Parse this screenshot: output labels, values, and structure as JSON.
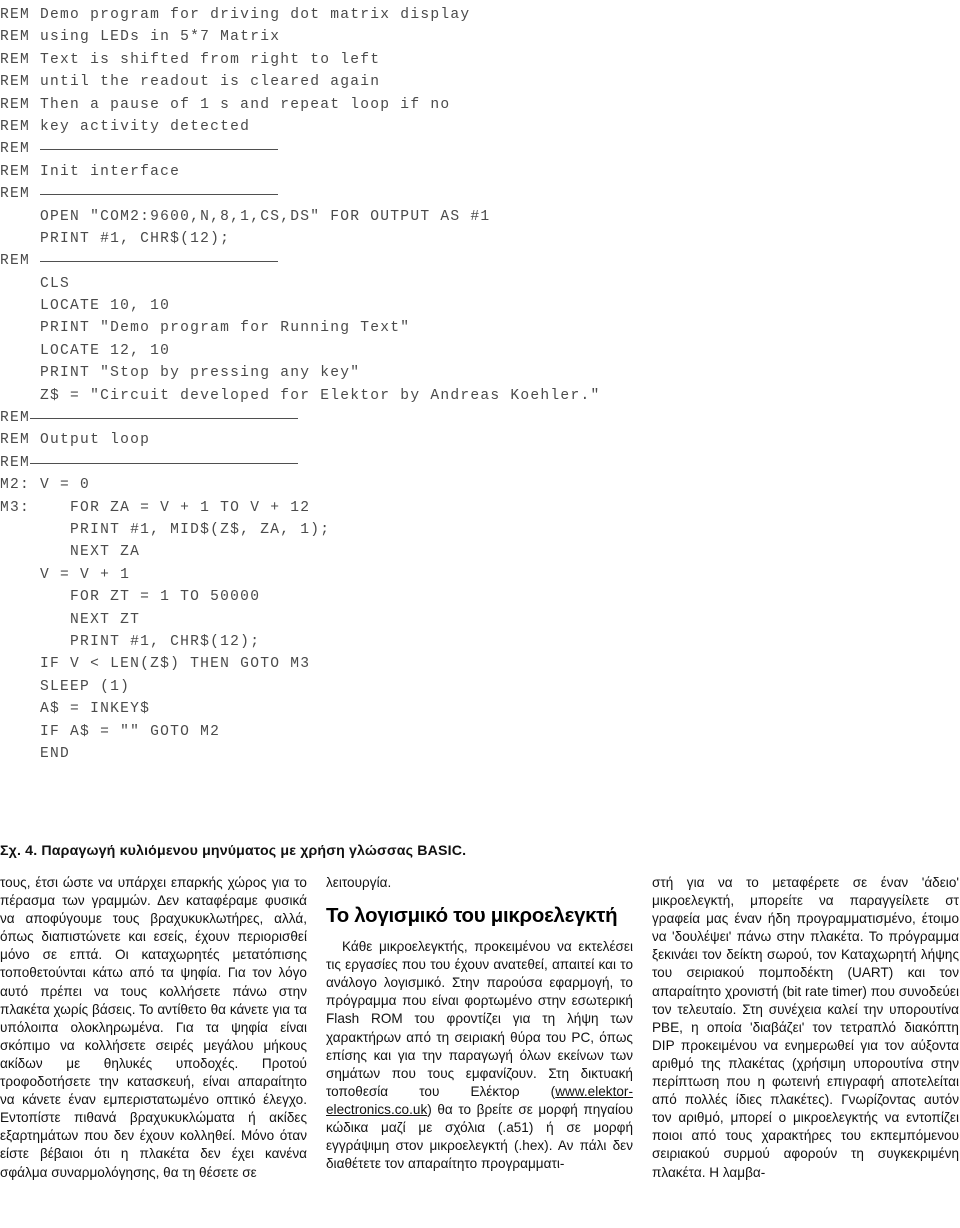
{
  "listing": {
    "lines": [
      {
        "type": "text",
        "text": "REM Demo program for driving dot matrix display"
      },
      {
        "type": "text",
        "text": "REM using LEDs in 5*7 Matrix"
      },
      {
        "type": "text",
        "text": "REM Text is shifted from right to left"
      },
      {
        "type": "text",
        "text": "REM until the readout is cleared again"
      },
      {
        "type": "text",
        "text": "REM Then a pause of 1 s and repeat loop if no"
      },
      {
        "type": "text",
        "text": "REM key activity detected"
      },
      {
        "type": "rule",
        "text": "REM",
        "style": "wide"
      },
      {
        "type": "text",
        "text": "REM Init interface"
      },
      {
        "type": "rule",
        "text": "REM",
        "style": "wide"
      },
      {
        "type": "text",
        "text": "    OPEN \"COM2:9600,N,8,1,CS,DS\" FOR OUTPUT AS #1"
      },
      {
        "type": "text",
        "text": "    PRINT #1, CHR$(12);"
      },
      {
        "type": "rule",
        "text": "REM",
        "style": "wide"
      },
      {
        "type": "text",
        "text": "    CLS"
      },
      {
        "type": "text",
        "text": "    LOCATE 10, 10"
      },
      {
        "type": "text",
        "text": "    PRINT \"Demo program for Running Text\""
      },
      {
        "type": "text",
        "text": "    LOCATE 12, 10"
      },
      {
        "type": "text",
        "text": "    PRINT \"Stop by pressing any key\""
      },
      {
        "type": "text",
        "text": "    Z$ = \"Circuit developed for Elektor by Andreas Koehler.\""
      },
      {
        "type": "rule",
        "text": "REM",
        "style": "tight"
      },
      {
        "type": "text",
        "text": "REM Output loop"
      },
      {
        "type": "rule",
        "text": "REM",
        "style": "tight"
      },
      {
        "type": "text",
        "text": "M2: V = 0"
      },
      {
        "type": "text",
        "text": "M3:    FOR ZA = V + 1 TO V + 12"
      },
      {
        "type": "text",
        "text": "       PRINT #1, MID$(Z$, ZA, 1);"
      },
      {
        "type": "text",
        "text": "       NEXT ZA"
      },
      {
        "type": "text",
        "text": "    V = V + 1"
      },
      {
        "type": "text",
        "text": "       FOR ZT = 1 TO 50000"
      },
      {
        "type": "text",
        "text": "       NEXT ZT"
      },
      {
        "type": "text",
        "text": "       PRINT #1, CHR$(12);"
      },
      {
        "type": "text",
        "text": "    IF V < LEN(Z$) THEN GOTO M3"
      },
      {
        "type": "text",
        "text": "    SLEEP (1)"
      },
      {
        "type": "text",
        "text": "    A$ = INKEY$"
      },
      {
        "type": "text",
        "text": "    IF A$ = \"\" GOTO M2"
      },
      {
        "type": "text",
        "text": "    END"
      }
    ]
  },
  "caption": {
    "number": "Σχ. 4.",
    "text": "Παραγωγή κυλιόμενου μηνύματος με χρήση γλώσσας BASIC.",
    "full": "Σχ. 4. Παραγωγή κυλιόμενου μηνύματος με χρήση γλώσσας BASIC."
  },
  "article": {
    "column1": {
      "paragraph": "τους, έτσι ώστε να υπάρχει επαρκής χώρος για το πέρασμα των γραμμών. Δεν καταφέραμε φυσικά να αποφύγουμε τους βραχυκυκλωτήρες, αλλά, όπως διαπιστώνετε και εσείς, έχουν περιορισθεί μόνο σε επτά. Οι καταχωρητές μετατόπισης τοποθετούνται κάτω από τα ψηφία. Για τον λόγο αυτό πρέπει να τους κολλήσετε πάνω στην πλακέτα χωρίς βάσεις. Το αντίθετο θα κάνετε για τα υπόλοιπα ολοκληρωμένα. Για τα ψηφία είναι σκόπιμο να κολλήσετε σειρές μεγάλου μήκους ακίδων με θηλυκές υποδοχές. Προτού τροφοδοτήσετε την κατασκευή, είναι απαραίτητο να κάνετε έναν εμπεριστατωμένο οπτικό έλεγχο. Εντοπίστε πιθανά βραχυκυκλώματα ή ακίδες εξαρτημάτων που δεν έχουν κολληθεί. Μόνο όταν είστε βέβαιοι ότι η πλακέτα δεν έχει κανένα σφάλμα συναρμολόγησης, θα τη θέσετε σε"
    },
    "column2": {
      "paragraph_top": "λειτουργία.",
      "heading": "Το λογισμικό του μικροελεγκτή",
      "paragraph_body_before_link": "Κάθε μικροελεγκτής, προκειμένου να εκτελέσει τις εργασίες που του έχουν ανατεθεί, απαιτεί και το ανάλογο λογισμικό. Στην παρούσα εφαρμογή, το πρόγραμμα που είναι φορτωμένο στην εσωτερική Flash ROM του φροντίζει για τη λήψη των χαρακτήρων από τη σειριακή θύρα του PC, όπως επίσης και για την παραγωγή όλων εκείνων των σημάτων που τους εμφανίζουν. Στη δικτυακή τοποθεσία του Ελέκτορ (",
      "link_text": "www.elektor-electronics.co.uk",
      "paragraph_body_after_link": ") θα το βρείτε σε μορφή πηγαίου κώδικα μαζί με σχόλια (.a51) ή σε μορφή εγγράψιμη στον μικροελεγκτή (.hex). Αν πάλι δεν διαθέτετε τον απαραίτητο προγραμματι-"
    },
    "column3": {
      "paragraph": "στή για να το μεταφέρετε σε έναν 'άδειο' μικροελεγκτή, μπορείτε να παραγγείλετε στ γραφεία μας έναν ήδη προγραμματισμένο, έτοιμο να 'δουλέψει' πάνω στην πλακέτα. Το πρόγραμμα ξεκινάει τον δείκτη σωρού, τον Καταχωρητή λήψης του σειριακού πομποδέκτη (UART) και τον απαραίτητο χρονιστή (bit rate timer) που συνοδεύει τον τελευταίο. Στη συνέχεια καλεί την υπορουτίνα PBE, η οποία 'διαβάζει' τον τετραπλό διακόπτη DIP προκειμένου να ενημερωθεί για τον αύξοντα αριθμό της πλακέτας (χρήσιμη υπορουτίνα στην περίπτωση που η φωτεινή επιγραφή αποτελείται από πολλές ίδιες πλακέτες). Γνωρίζοντας αυτόν τον αριθμό, μπορεί ο μικροελεγκτής να εντοπίζει ποιοι από τους χαρακτήρες του εκπεμπόμενου σειριακού συρμού αφορούν τη συγκεκριμένη πλακέτα. Η λαμβα-"
    }
  },
  "colors": {
    "page_background": "#ffffff",
    "code_text": "#4a4a4a",
    "code_rule": "#4f4f4f",
    "body_text": "#111111",
    "heading_text": "#000000"
  }
}
